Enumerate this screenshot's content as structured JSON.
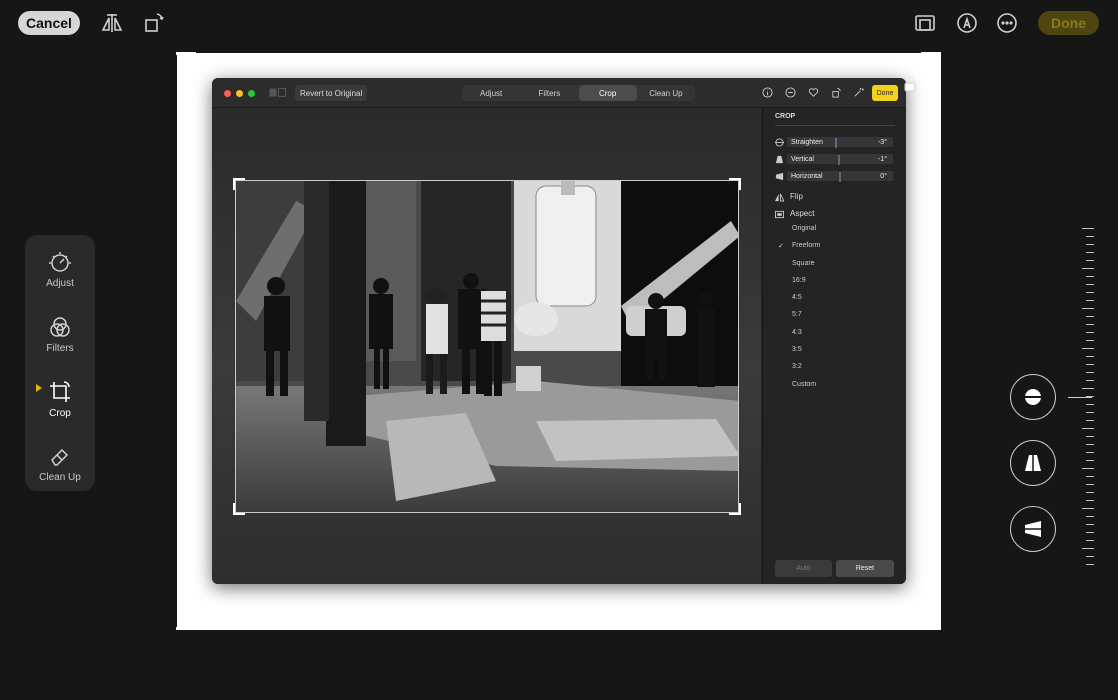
{
  "topbar": {
    "cancel_label": "Cancel",
    "done_label": "Done",
    "icons": [
      "flip-horizontal-icon",
      "rotate-icon",
      "aspect-icon",
      "markup-icon",
      "more-icon"
    ]
  },
  "mac_window": {
    "revert_label": "Revert to Original",
    "tabs": [
      {
        "label": "Adjust",
        "active": false
      },
      {
        "label": "Filters",
        "active": false
      },
      {
        "label": "Crop",
        "active": true
      },
      {
        "label": "Clean Up",
        "active": false
      }
    ],
    "done_label": "Done",
    "panel": {
      "title": "CROP",
      "sliders": [
        {
          "label": "Straighten",
          "value": "-3°"
        },
        {
          "label": "Vertical",
          "value": "-1°"
        },
        {
          "label": "Horizontal",
          "value": "0°"
        }
      ],
      "flip_label": "Flip",
      "aspect_label": "Aspect",
      "aspect_options": [
        "Original",
        "Freeform",
        "Square",
        "16:9",
        "4:5",
        "5:7",
        "4:3",
        "3:5",
        "3:2",
        "Custom"
      ],
      "aspect_selected": "Freeform",
      "auto_label": "Auto",
      "reset_label": "Reset"
    }
  },
  "tools": [
    {
      "label": "Adjust",
      "icon": "adjust-icon",
      "active": false
    },
    {
      "label": "Filters",
      "icon": "filters-icon",
      "active": false
    },
    {
      "label": "Crop",
      "icon": "crop-icon",
      "active": true
    },
    {
      "label": "Clean Up",
      "icon": "eraser-icon",
      "active": false
    }
  ],
  "colors": {
    "accent": "#e9b500",
    "done_button": "#4e4510",
    "background": "#161616"
  }
}
